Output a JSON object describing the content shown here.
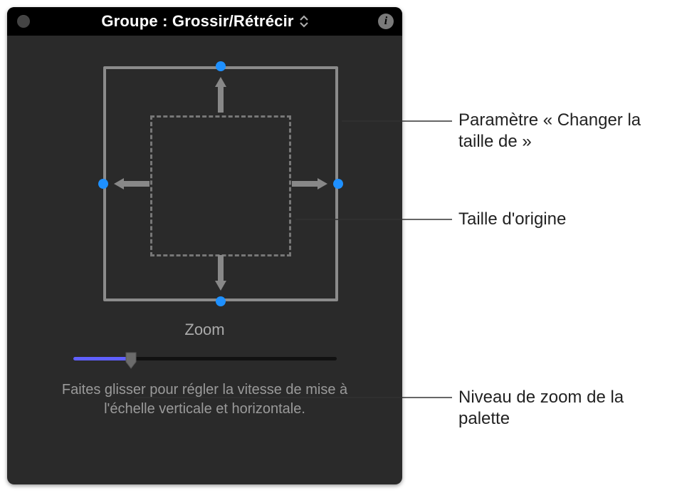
{
  "header": {
    "title": "Groupe : Grossir/Rétrécir",
    "info_icon_glyph": "i"
  },
  "canvas": {
    "outer_rect_name": "resize-target-box",
    "inner_rect_name": "original-size-box"
  },
  "zoom": {
    "label": "Zoom",
    "help_text": "Faites glisser pour régler la vitesse de mise à l'échelle verticale et horizontale."
  },
  "callouts": {
    "resize_param": "Paramètre « Changer la taille de »",
    "original_size": "Taille d'origine",
    "zoom_level": "Niveau de zoom de la palette"
  }
}
